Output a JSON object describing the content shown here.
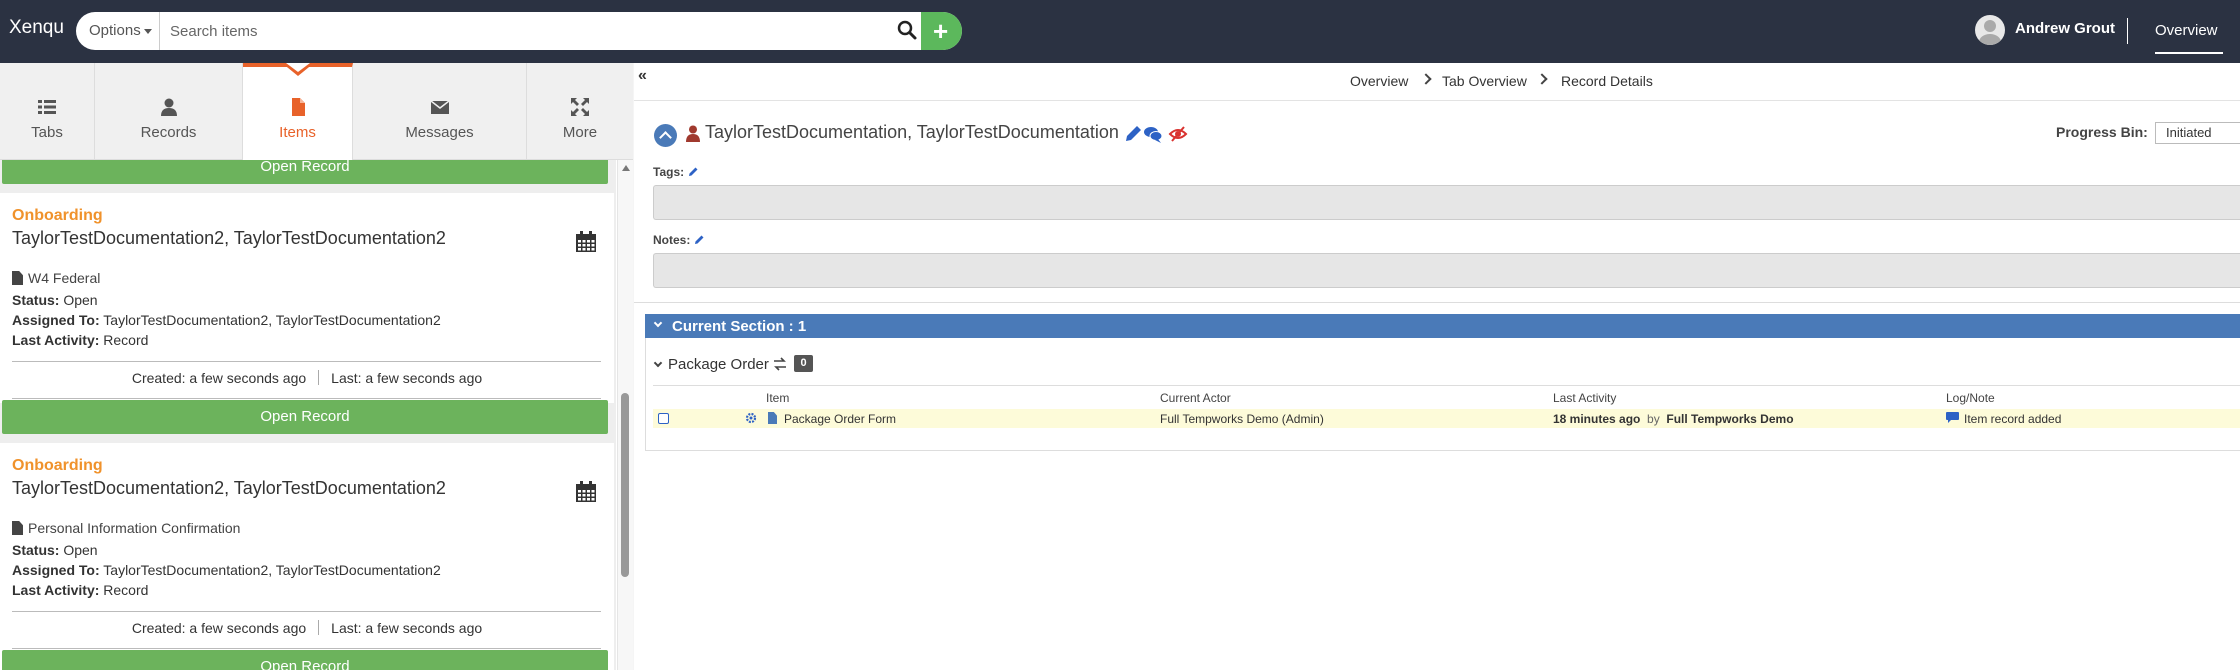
{
  "app": {
    "brand": "Xenqu"
  },
  "search": {
    "options_label": "Options",
    "placeholder": "Search items",
    "add_label": "+"
  },
  "user": {
    "name": "Andrew Grout",
    "nav_link": "Overview"
  },
  "nav_tabs": [
    {
      "label": "Tabs",
      "icon": "list-icon"
    },
    {
      "label": "Records",
      "icon": "person-icon"
    },
    {
      "label": "Items",
      "icon": "file-icon",
      "active": true
    },
    {
      "label": "Messages",
      "icon": "envelope-icon"
    },
    {
      "label": "More",
      "icon": "expand-icon"
    }
  ],
  "list": {
    "top_button": "Open Record",
    "cards": [
      {
        "category": "Onboarding",
        "title": "TaylorTestDocumentation2, TaylorTestDocumentation2",
        "document": "W4 Federal",
        "status_label": "Status:",
        "status": "Open",
        "assigned_label": "Assigned To:",
        "assigned": "TaylorTestDocumentation2, TaylorTestDocumentation2",
        "activity_label": "Last Activity:",
        "activity": "Record",
        "created": "Created: a few seconds ago",
        "last": "Last: a few seconds ago",
        "button": "Open Record"
      },
      {
        "category": "Onboarding",
        "title": "TaylorTestDocumentation2, TaylorTestDocumentation2",
        "document": "Personal Information Confirmation",
        "status_label": "Status:",
        "status": "Open",
        "assigned_label": "Assigned To:",
        "assigned": "TaylorTestDocumentation2, TaylorTestDocumentation2",
        "activity_label": "Last Activity:",
        "activity": "Record",
        "created": "Created: a few seconds ago",
        "last": "Last: a few seconds ago",
        "button": "Open Record"
      }
    ]
  },
  "breadcrumb": [
    "Overview",
    "Tab Overview",
    "Record Details"
  ],
  "record": {
    "title": "TaylorTestDocumentation, TaylorTestDocumentation",
    "progress_label": "Progress Bin:",
    "progress_value": "Initiated",
    "tags_label": "Tags:",
    "notes_label": "Notes:"
  },
  "section": {
    "title": "Current Section : 1",
    "package": "Package Order",
    "count": "0",
    "columns": [
      "Item",
      "Current Actor",
      "Last Activity",
      "Log/Note"
    ],
    "rows": [
      {
        "item": "Package Order Form",
        "actor": "Full Tempworks Demo (Admin)",
        "activity_time": "18 minutes ago",
        "activity_by": "by",
        "activity_user": "Full Tempworks Demo",
        "log": "Item record added"
      }
    ]
  },
  "colors": {
    "topbar": "#2b3242",
    "accent": "#e8622a",
    "green": "#6cb35c",
    "section_blue": "#4a7ab8",
    "category": "#f0922b"
  }
}
